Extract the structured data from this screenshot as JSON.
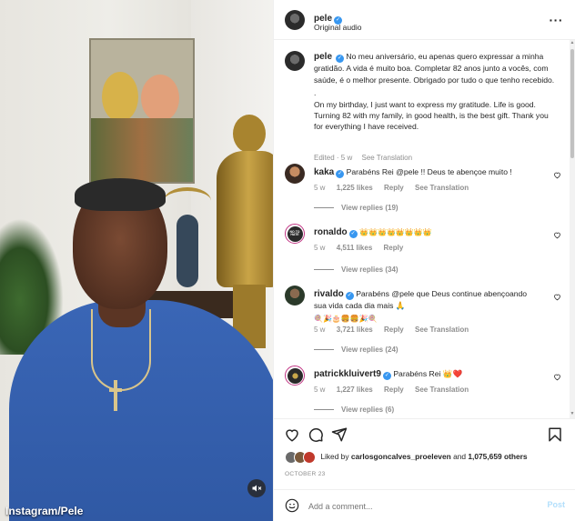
{
  "video": {
    "credit": "Instagram/Pele"
  },
  "header": {
    "username": "pele",
    "subtitle": "Original audio"
  },
  "caption": {
    "username": "pele",
    "text_pt": "No meu aniversário, eu apenas quero expressar a minha gratidão. A vida é muito boa. Completar 82 anos junto a vocês, com saúde, é o melhor presente. Obrigado por tudo o que tenho recebido.",
    "separator": ".",
    "text_en": "On my birthday, I just want to express my gratitude. Life is good. Turning 82 with my family, in good health, is the best gift. Thank you for everything I have received.",
    "edited": "Edited · 5 w",
    "see_translation": "See Translation"
  },
  "comments": [
    {
      "username": "kaka",
      "text": "Parabéns Rei @pele !! Deus te abençoe muito !",
      "age": "5 w",
      "likes": "1,225 likes",
      "reply": "Reply",
      "translation": "See Translation",
      "replies": "View replies (19)"
    },
    {
      "username": "ronaldo",
      "text": "👑👑👑👑👑👑👑👑",
      "age": "5 w",
      "likes": "4,511 likes",
      "reply": "Reply",
      "translation": "",
      "replies": "View replies (34)"
    },
    {
      "username": "rivaldo",
      "text": "Parabéns @pele que Deus continue abençoando sua vida cada dia mais 🙏",
      "text_line2": "🍭🎉🎂🍔🍔🎉🍭",
      "age": "5 w",
      "likes": "3,721 likes",
      "reply": "Reply",
      "translation": "See Translation",
      "replies": "View replies (24)"
    },
    {
      "username": "patrickkluivert9",
      "text": "Parabéns Rei 👑❤️",
      "age": "5 w",
      "likes": "1,227 likes",
      "reply": "Reply",
      "translation": "See Translation",
      "replies": "View replies (6)"
    }
  ],
  "likes": {
    "prefix": "Liked by",
    "user": "carlosgoncalves_proeleven",
    "and": "and",
    "count": "1,075,659 others"
  },
  "date": "OCTOBER 23",
  "add_comment": {
    "placeholder": "Add a comment...",
    "post_label": "Post"
  },
  "avatar_ronaldo_text": "NO TO HATE",
  "colors": {
    "verified": "#3897f0",
    "meta": "#8e8e8e",
    "post": "#b2dffc",
    "story_ring": "#c13584"
  }
}
